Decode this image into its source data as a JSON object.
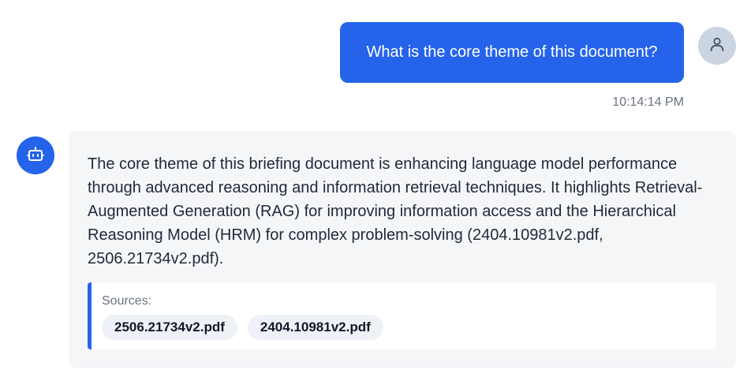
{
  "user_message": {
    "text": "What is the core theme of this document?",
    "timestamp": "10:14:14 PM",
    "avatar_icon": "user-icon"
  },
  "bot_message": {
    "avatar_icon": "robot-icon",
    "text": "The core theme of this briefing document is enhancing language model performance through advanced reasoning and information retrieval techniques. It highlights Retrieval-Augmented Generation (RAG) for improving information access and the Hierarchical Reasoning Model (HRM) for complex problem-solving (2404.10981v2.pdf, 2506.21734v2.pdf).",
    "sources_label": "Sources:",
    "sources": [
      "2506.21734v2.pdf",
      "2404.10981v2.pdf"
    ]
  },
  "colors": {
    "accent": "#2563eb",
    "user_avatar_bg": "#cbd5e1",
    "card_bg": "#f5f6f8",
    "chip_bg": "#eef1f5"
  }
}
